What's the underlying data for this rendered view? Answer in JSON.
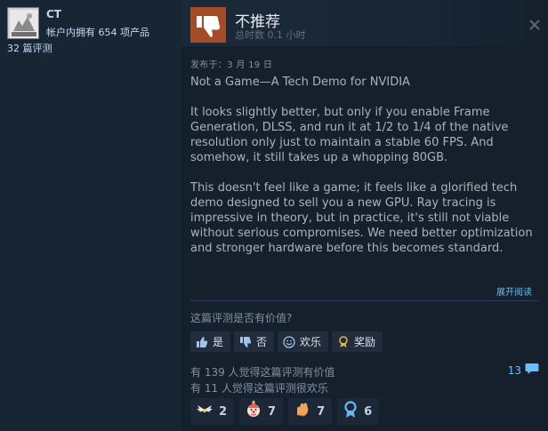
{
  "author": {
    "name": "CT",
    "products": "帐户内拥有 654 项产品",
    "reviews": "32 篇评测"
  },
  "review": {
    "recommendation": "不推荐",
    "hours": "总时数 0.1 小时",
    "posted": "发布于：3 月 19 日",
    "paragraphs": [
      "Not a Game—A Tech Demo for NVIDIA",
      "It looks slightly better, but only if you enable Frame Generation, DLSS, and run it at 1/2 to 1/4 of the native resolution only just to maintain a stable 60 FPS. And somehow, it still takes up a whopping 80GB.",
      "This doesn't feel like a game; it feels like a glorified tech demo designed to sell you a new GPU. Ray tracing is impressive in theory, but in practice, it's still not viable without serious compromises. We need better optimization and stronger hardware before this becomes standard."
    ],
    "expand_label": "展开阅读"
  },
  "feedback": {
    "question": "这篇评测是否有价值?",
    "buttons": {
      "yes": "是",
      "no": "否",
      "funny": "欢乐",
      "award": "奖励"
    },
    "helpful_count_text": "有 139 人觉得这篇评测有价值",
    "funny_count_text": "有 11 人觉得这篇评测很欢乐",
    "comment_count": "13"
  },
  "awards": [
    {
      "icon": "wings-award-icon",
      "count": "2"
    },
    {
      "icon": "clown-award-icon",
      "count": "7"
    },
    {
      "icon": "hand-award-icon",
      "count": "7"
    },
    {
      "icon": "ribbon-award-icon",
      "count": "6"
    }
  ],
  "colors": {
    "not_recommended": "#a34c25",
    "link": "#66c0f4",
    "background": "#16202d"
  }
}
